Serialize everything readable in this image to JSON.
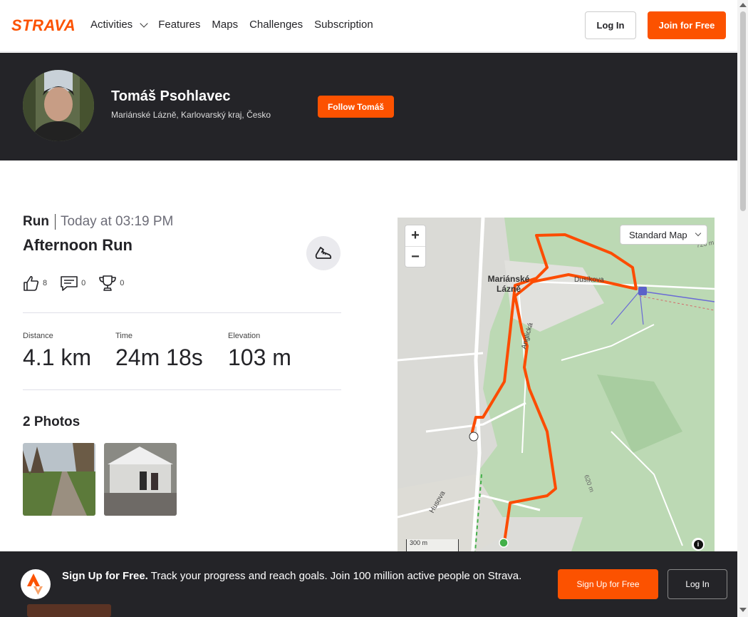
{
  "brand": {
    "logo_text": "STRAVA",
    "accent": "#fc5200",
    "dark_band": "#242428"
  },
  "nav": {
    "links": [
      "Activities",
      "Features",
      "Maps",
      "Challenges",
      "Subscription"
    ],
    "login_label": "Log In",
    "join_label": "Join for Free"
  },
  "profile": {
    "name": "Tomáš Psohlavec",
    "location": "Mariánské Lázně, Karlovarský kraj, Česko",
    "follow_label": "Follow Tomáš"
  },
  "activity": {
    "type": "Run",
    "time": "Today at 03:19 PM",
    "title": "Afternoon Run",
    "kudos_count": "8",
    "comments_count": "0",
    "achievements_count": "0",
    "stats": [
      {
        "label": "Distance",
        "value": "4.1 km"
      },
      {
        "label": "Time",
        "value": "24m 18s"
      },
      {
        "label": "Elevation",
        "value": "103 m"
      }
    ],
    "photos_title": "2 Photos"
  },
  "map": {
    "style_select": "Standard Map",
    "zoom_in": "+",
    "zoom_out": "−",
    "scale_label": "300 m",
    "town_label_1": "Mariánské",
    "town_label_2": "Lázně",
    "street_1": "Dusíkova",
    "street_2": "Anglická",
    "street_3": "Husova",
    "contour_1": "720 m",
    "contour_2": "620 m",
    "route_color": "#fc4c02"
  },
  "banner": {
    "headline": "Sign Up for Free.",
    "body": " Track your progress and reach goals. Join 100 million active people on Strava.",
    "signup_label": "Sign Up for Free",
    "login_label": "Log In"
  }
}
